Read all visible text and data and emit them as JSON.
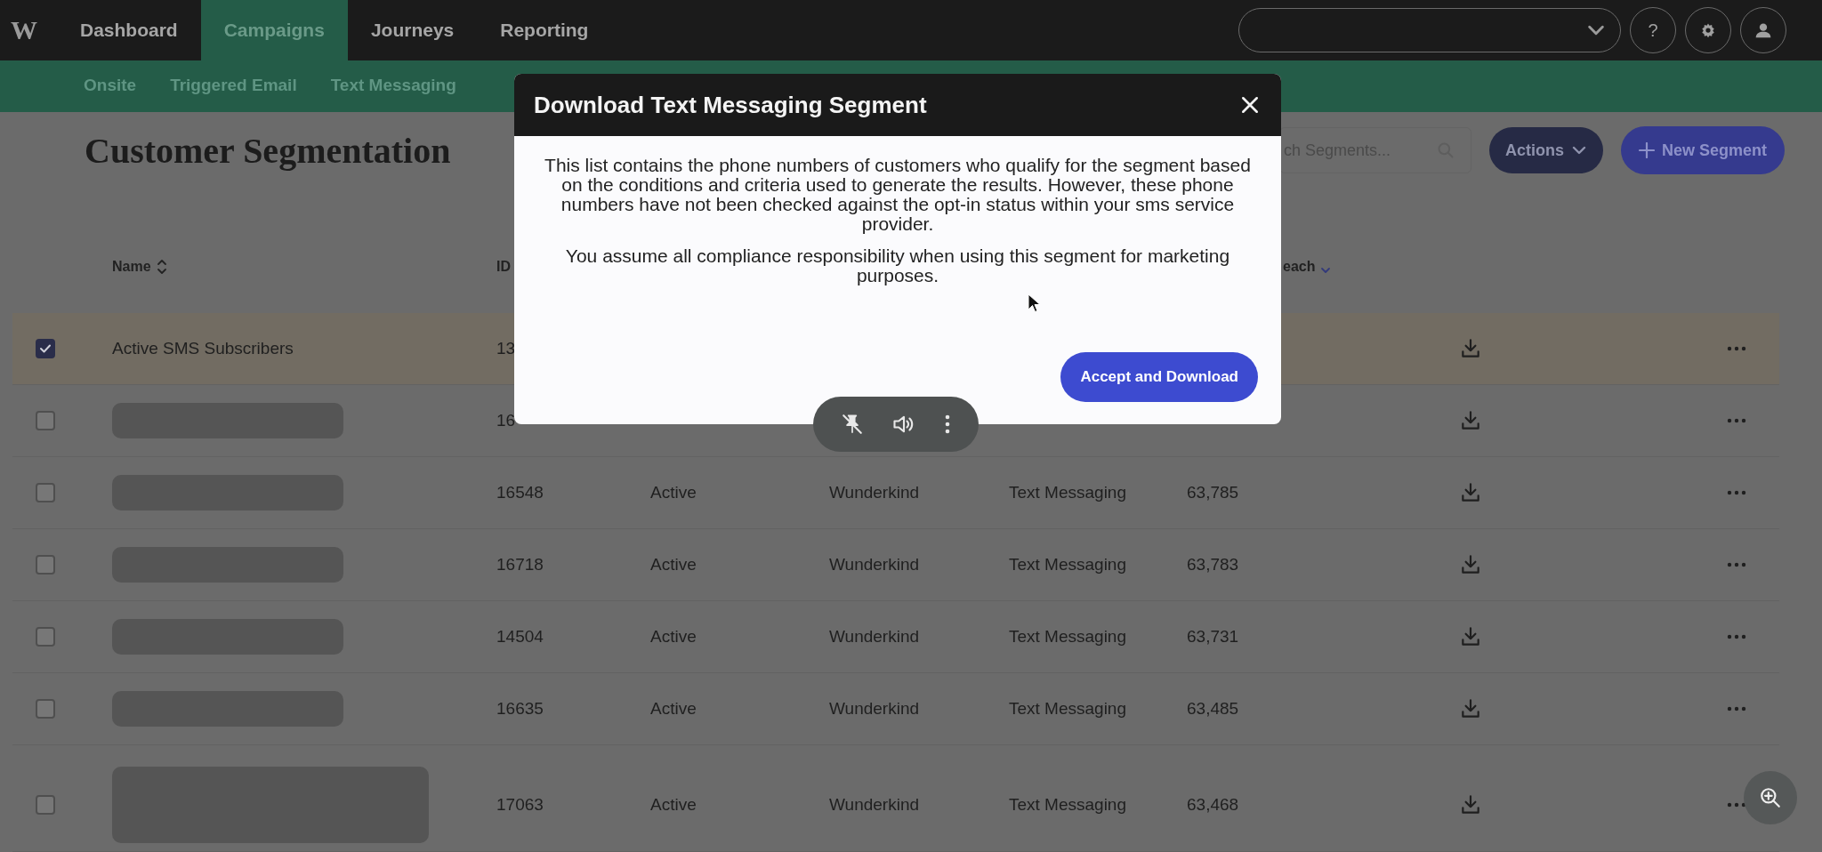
{
  "top_bar": {
    "logo": "W",
    "tabs": [
      {
        "label": "Dashboard",
        "selected": false
      },
      {
        "label": "Campaigns",
        "selected": true
      },
      {
        "label": "Journeys",
        "selected": false
      },
      {
        "label": "Reporting",
        "selected": false
      }
    ],
    "help": "?"
  },
  "sub_nav": {
    "tabs": [
      {
        "label": "Onsite",
        "selected": false
      },
      {
        "label": "Triggered Email",
        "selected": false
      },
      {
        "label": "Text Messaging",
        "selected": false
      }
    ]
  },
  "page": {
    "title": "Customer Segmentation",
    "search": {
      "placeholder": "ch Segments..."
    },
    "actions_button": "Actions",
    "new_button": "New Segment"
  },
  "table": {
    "headers": {
      "name": {
        "label": "Name",
        "sorted_descending": false
      },
      "id": {
        "label": "ID"
      },
      "column_7": {
        "label": "each",
        "sorted_descending": true
      }
    },
    "rows": [
      {
        "selected": true,
        "kind": "text",
        "name": "Active SMS Subscribers",
        "id": "13"
      },
      {
        "selected": false,
        "kind": "redacted",
        "id": "16"
      },
      {
        "selected": false,
        "kind": "redacted",
        "id": "16548",
        "column_4": "Active",
        "column_5": "Wunderkind",
        "column_6": "Text Messaging",
        "column_7": "63,785"
      },
      {
        "selected": false,
        "kind": "redacted",
        "id": "16718",
        "column_4": "Active",
        "column_5": "Wunderkind",
        "column_6": "Text Messaging",
        "column_7": "63,783"
      },
      {
        "selected": false,
        "kind": "redacted",
        "id": "14504",
        "column_4": "Active",
        "column_5": "Wunderkind",
        "column_6": "Text Messaging",
        "column_7": "63,731"
      },
      {
        "selected": false,
        "kind": "redacted",
        "id": "16635",
        "column_4": "Active",
        "column_5": "Wunderkind",
        "column_6": "Text Messaging",
        "column_7": "63,485"
      },
      {
        "selected": false,
        "kind": "redacted_tall",
        "id": "17063",
        "column_4": "Active",
        "column_5": "Wunderkind",
        "column_6": "Text Messaging",
        "column_7": "63,468"
      }
    ]
  },
  "modal": {
    "title": "Download Text Messaging Segment",
    "paragraphs": [
      "This list contains the phone numbers of customers who qualify for the segment based on the conditions and criteria used to generate the results. However, these phone numbers have not been checked against the opt-in status within your sms service provider.",
      "You assume all compliance responsibility when using this segment for marketing purposes."
    ],
    "button": "Accept and Download"
  }
}
